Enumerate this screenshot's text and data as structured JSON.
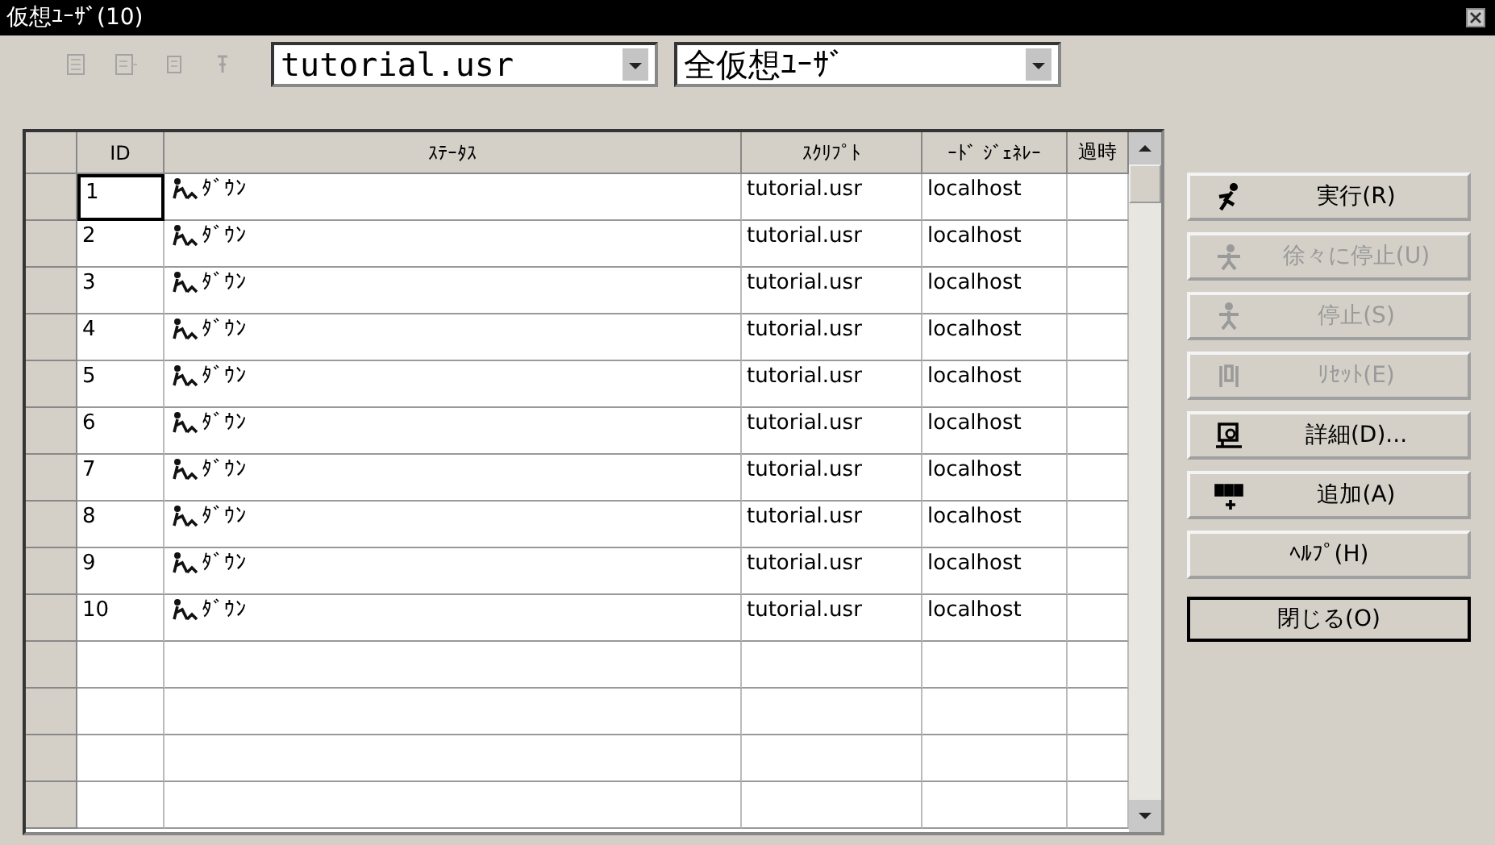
{
  "window": {
    "title": "仮想ﾕｰｻﾞ(10)"
  },
  "toolbar": {
    "script_combo": {
      "value": "tutorial.usr"
    },
    "filter_combo": {
      "value": "全仮想ﾕｰｻﾞ"
    }
  },
  "table": {
    "columns": [
      "ID",
      "ｽﾃｰﾀｽ",
      "ｽｸﾘﾌﾟﾄ",
      "ｰﾄﾞ ｼﾞｪﾈﾚｰ",
      "過時"
    ],
    "rows": [
      {
        "id": "1",
        "status": "ﾀﾞｳﾝ",
        "script": "tutorial.usr",
        "load_generator": "localhost",
        "focused": true
      },
      {
        "id": "2",
        "status": "ﾀﾞｳﾝ",
        "script": "tutorial.usr",
        "load_generator": "localhost",
        "focused": false
      },
      {
        "id": "3",
        "status": "ﾀﾞｳﾝ",
        "script": "tutorial.usr",
        "load_generator": "localhost",
        "focused": false
      },
      {
        "id": "4",
        "status": "ﾀﾞｳﾝ",
        "script": "tutorial.usr",
        "load_generator": "localhost",
        "focused": false
      },
      {
        "id": "5",
        "status": "ﾀﾞｳﾝ",
        "script": "tutorial.usr",
        "load_generator": "localhost",
        "focused": false
      },
      {
        "id": "6",
        "status": "ﾀﾞｳﾝ",
        "script": "tutorial.usr",
        "load_generator": "localhost",
        "focused": false
      },
      {
        "id": "7",
        "status": "ﾀﾞｳﾝ",
        "script": "tutorial.usr",
        "load_generator": "localhost",
        "focused": false
      },
      {
        "id": "8",
        "status": "ﾀﾞｳﾝ",
        "script": "tutorial.usr",
        "load_generator": "localhost",
        "focused": false
      },
      {
        "id": "9",
        "status": "ﾀﾞｳﾝ",
        "script": "tutorial.usr",
        "load_generator": "localhost",
        "focused": false
      },
      {
        "id": "10",
        "status": "ﾀﾞｳﾝ",
        "script": "tutorial.usr",
        "load_generator": "localhost",
        "focused": false
      }
    ]
  },
  "buttons": [
    {
      "label": "実行(R)",
      "kind": "run",
      "disabled": false,
      "default": false
    },
    {
      "label": "徐々に停止(U)",
      "kind": "gradual",
      "disabled": true,
      "default": false
    },
    {
      "label": "停止(S)",
      "kind": "stop",
      "disabled": true,
      "default": false
    },
    {
      "label": "ﾘｾｯﾄ(E)",
      "kind": "reset",
      "disabled": true,
      "default": false
    },
    {
      "label": "詳細(D)...",
      "kind": "details",
      "disabled": false,
      "default": false
    },
    {
      "label": "追加(A)",
      "kind": "add",
      "disabled": false,
      "default": false
    },
    {
      "label": "ﾍﾙﾌﾟ(H)",
      "kind": "plain",
      "disabled": false,
      "default": false
    },
    {
      "label": "閉じる(O)",
      "kind": "plain",
      "disabled": false,
      "default": true
    }
  ]
}
